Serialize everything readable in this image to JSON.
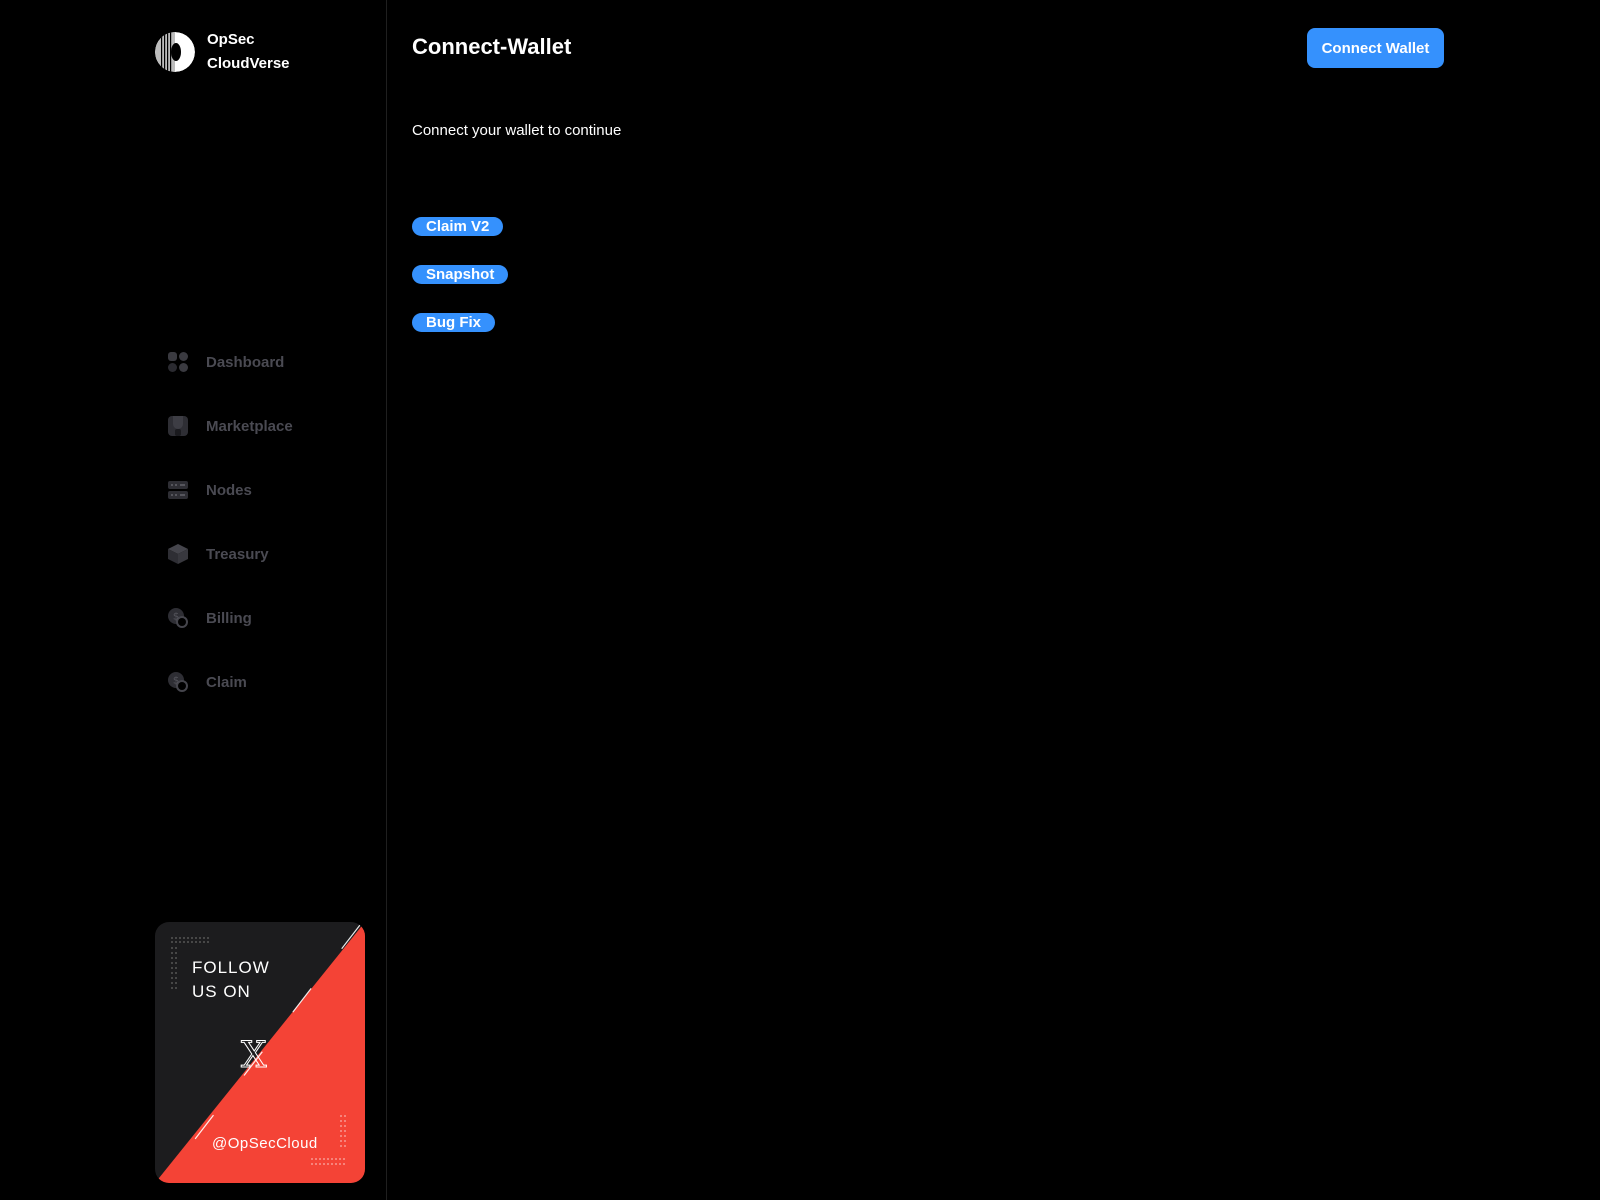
{
  "brand": {
    "line1": "OpSec",
    "line2": "CloudVerse"
  },
  "sidebar": {
    "items": [
      {
        "label": "Dashboard",
        "icon": "dashboard-icon"
      },
      {
        "label": "Marketplace",
        "icon": "marketplace-icon"
      },
      {
        "label": "Nodes",
        "icon": "nodes-icon"
      },
      {
        "label": "Treasury",
        "icon": "treasury-icon"
      },
      {
        "label": "Billing",
        "icon": "billing-icon"
      },
      {
        "label": "Claim",
        "icon": "claim-icon"
      }
    ]
  },
  "follow": {
    "line1": "FOLLOW",
    "line2": "US ON",
    "x_glyph": "X",
    "handle": "@OpSecCloud"
  },
  "header": {
    "title": "Connect-Wallet",
    "connect_label": "Connect Wallet"
  },
  "main": {
    "subtitle": "Connect your wallet to continue",
    "links": [
      "Claim V2",
      "Snapshot",
      "Bug Fix"
    ]
  },
  "colors": {
    "background": "#000000",
    "accent": "#3591fd",
    "nav_text": "#4a4a52",
    "card_dark": "#1c1c1e",
    "card_red": "#f44336"
  }
}
